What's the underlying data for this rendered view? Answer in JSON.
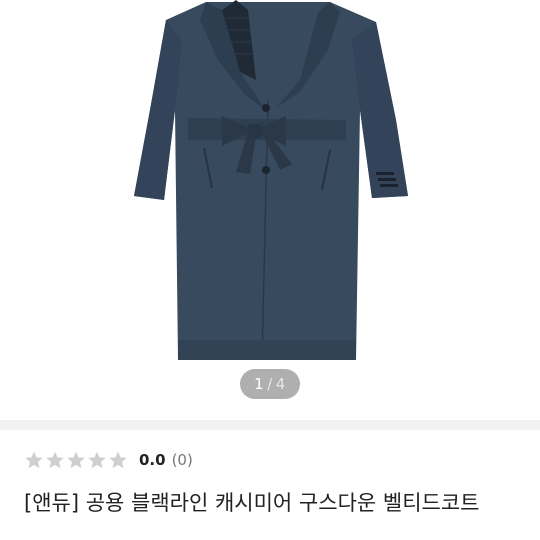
{
  "product": {
    "image_alt": "navy long cashmere belted coat",
    "pager": {
      "current": "1",
      "separator": "/",
      "total": "4"
    },
    "rating": {
      "score": "0.0",
      "count": "(0)",
      "stars": 0,
      "max_stars": 5
    },
    "title": "[앤듀] 공용 블랙라인 캐시미어 구스다운 벨티드코트"
  },
  "colors": {
    "coat": "#384a5e",
    "coat_shadow": "#2a3848",
    "star_empty": "#cfcfcf",
    "divider": "#f2f2f2"
  }
}
